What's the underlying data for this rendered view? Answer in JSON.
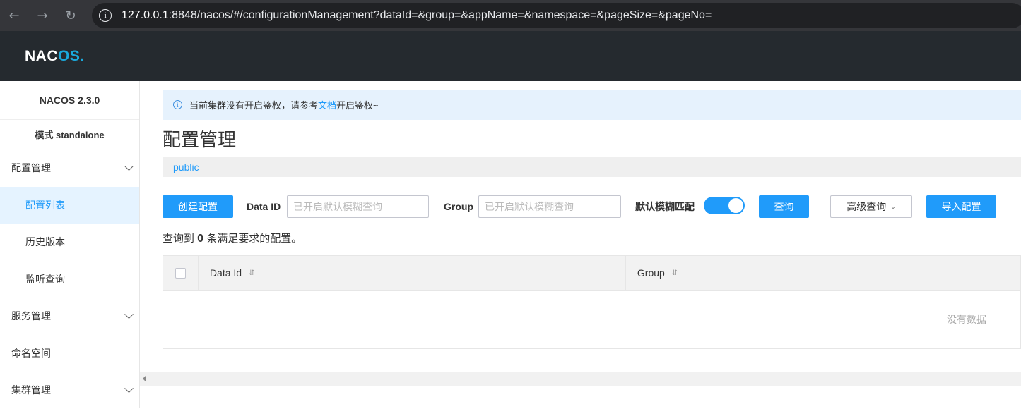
{
  "browser": {
    "back_icon": "←",
    "forward_icon": "→",
    "reload_icon": "↻",
    "info_icon": "i",
    "url_host": "127.0.0.1",
    "url_rest": ":8848/nacos/#/configurationManagement?dataId=&group=&appName=&namespace=&pageSize=&pageNo="
  },
  "header": {
    "logo_prefix": "NAC",
    "logo_oo": "OS",
    "logo_suffix": "."
  },
  "sidebar": {
    "version": "NACOS 2.3.0",
    "mode": "模式 standalone",
    "items": [
      {
        "label": "配置管理",
        "type": "group"
      },
      {
        "label": "配置列表",
        "type": "sub",
        "active": true
      },
      {
        "label": "历史版本",
        "type": "sub"
      },
      {
        "label": "监听查询",
        "type": "sub"
      },
      {
        "label": "服务管理",
        "type": "group"
      },
      {
        "label": "命名空间",
        "type": "plain"
      },
      {
        "label": "集群管理",
        "type": "group"
      }
    ]
  },
  "notice": {
    "icon": "i",
    "text_before": "当前集群没有开启鉴权，请参考",
    "link": "文档",
    "text_after": "开启鉴权~"
  },
  "page": {
    "title": "配置管理",
    "namespace": "public"
  },
  "toolbar": {
    "create_label": "创建配置",
    "dataid_label": "Data ID",
    "dataid_placeholder": "已开启默认模糊查询",
    "group_label": "Group",
    "group_placeholder": "已开启默认模糊查询",
    "fuzzy_label": "默认模糊匹配",
    "fuzzy_on": true,
    "query_label": "查询",
    "advanced_label": "高级查询",
    "advanced_arrow": "⌄",
    "import_label": "导入配置"
  },
  "result": {
    "prefix": "查询到 ",
    "count": "0",
    "suffix": " 条满足要求的配置。"
  },
  "table": {
    "columns": [
      "Data Id",
      "Group"
    ],
    "sort_icon": "⇵",
    "empty_text": "没有数据"
  },
  "colors": {
    "primary": "#209bfa",
    "header_bg": "#252a2f",
    "active_bg": "#e5f3ff"
  }
}
